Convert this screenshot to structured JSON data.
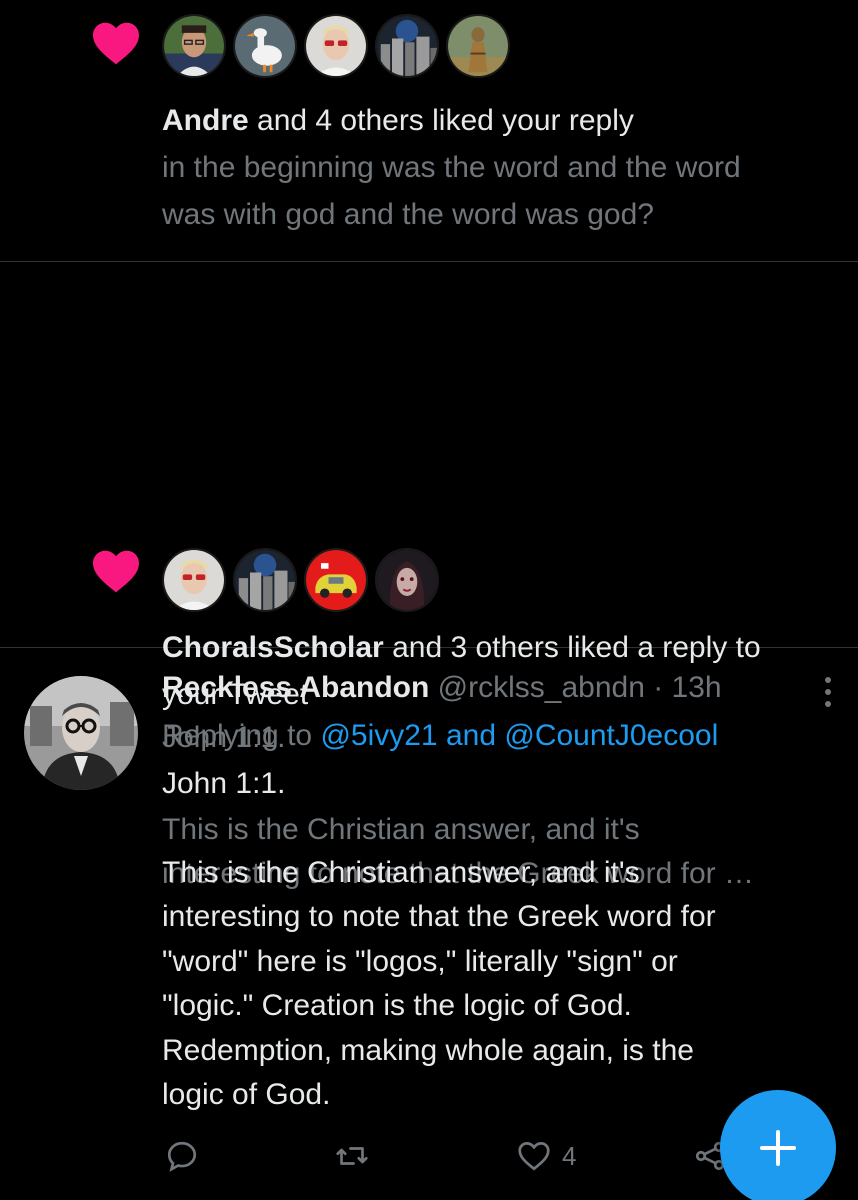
{
  "colors": {
    "background": "#000000",
    "text": "#e7e9ea",
    "muted": "#71767b",
    "link": "#1d9bf0",
    "like": "#f91880",
    "divider": "#2f3336",
    "fab": "#1d9bf0"
  },
  "notifications": [
    {
      "icon": "heart-icon",
      "avatars": [
        "avatar-man-glasses",
        "avatar-goose",
        "avatar-red-sunglasses",
        "avatar-city-night",
        "avatar-statue"
      ],
      "actor": "Andre",
      "action": " and 4 others liked your reply",
      "preview_lines": [
        "in the beginning was the word and the word",
        "was with god and the word was god?"
      ]
    },
    {
      "icon": "heart-icon",
      "avatars": [
        "avatar-red-sunglasses",
        "avatar-city-night",
        "avatar-yellow-car",
        "avatar-dark-portrait"
      ],
      "actor": "ChoralsScholar",
      "action_line1": " and 3 others liked a reply to",
      "action_line2": "your Tweet",
      "preview_line1": "John 1:1.",
      "preview_line2": "This is the Christian answer, and it's",
      "preview_line3": "interesting to note that the Greek word for …"
    }
  ],
  "tweet": {
    "display_name": "Reckless Abandon",
    "handle": "@rcklss_abndn",
    "separator": " · ",
    "time": "13h",
    "replying_prefix": "Replying to ",
    "mention1": "@5ivy21",
    "and": " and ",
    "mention2": "@CountJ0ecool",
    "body_line1": "John 1:1.",
    "body_lines": [
      "This is the Christian answer, and it's",
      "interesting to note that the Greek word for",
      "\"word\" here is \"logos,\" literally \"sign\" or",
      "\"logic.\" Creation is the logic of God.",
      "Redemption, making whole again, is the",
      "logic of God."
    ],
    "actions": {
      "reply_icon": "reply-icon",
      "retweet_icon": "retweet-icon",
      "like_icon": "heart-outline-icon",
      "like_count": "4",
      "share_icon": "share-icon"
    }
  },
  "fab": {
    "icon": "plus-icon"
  }
}
